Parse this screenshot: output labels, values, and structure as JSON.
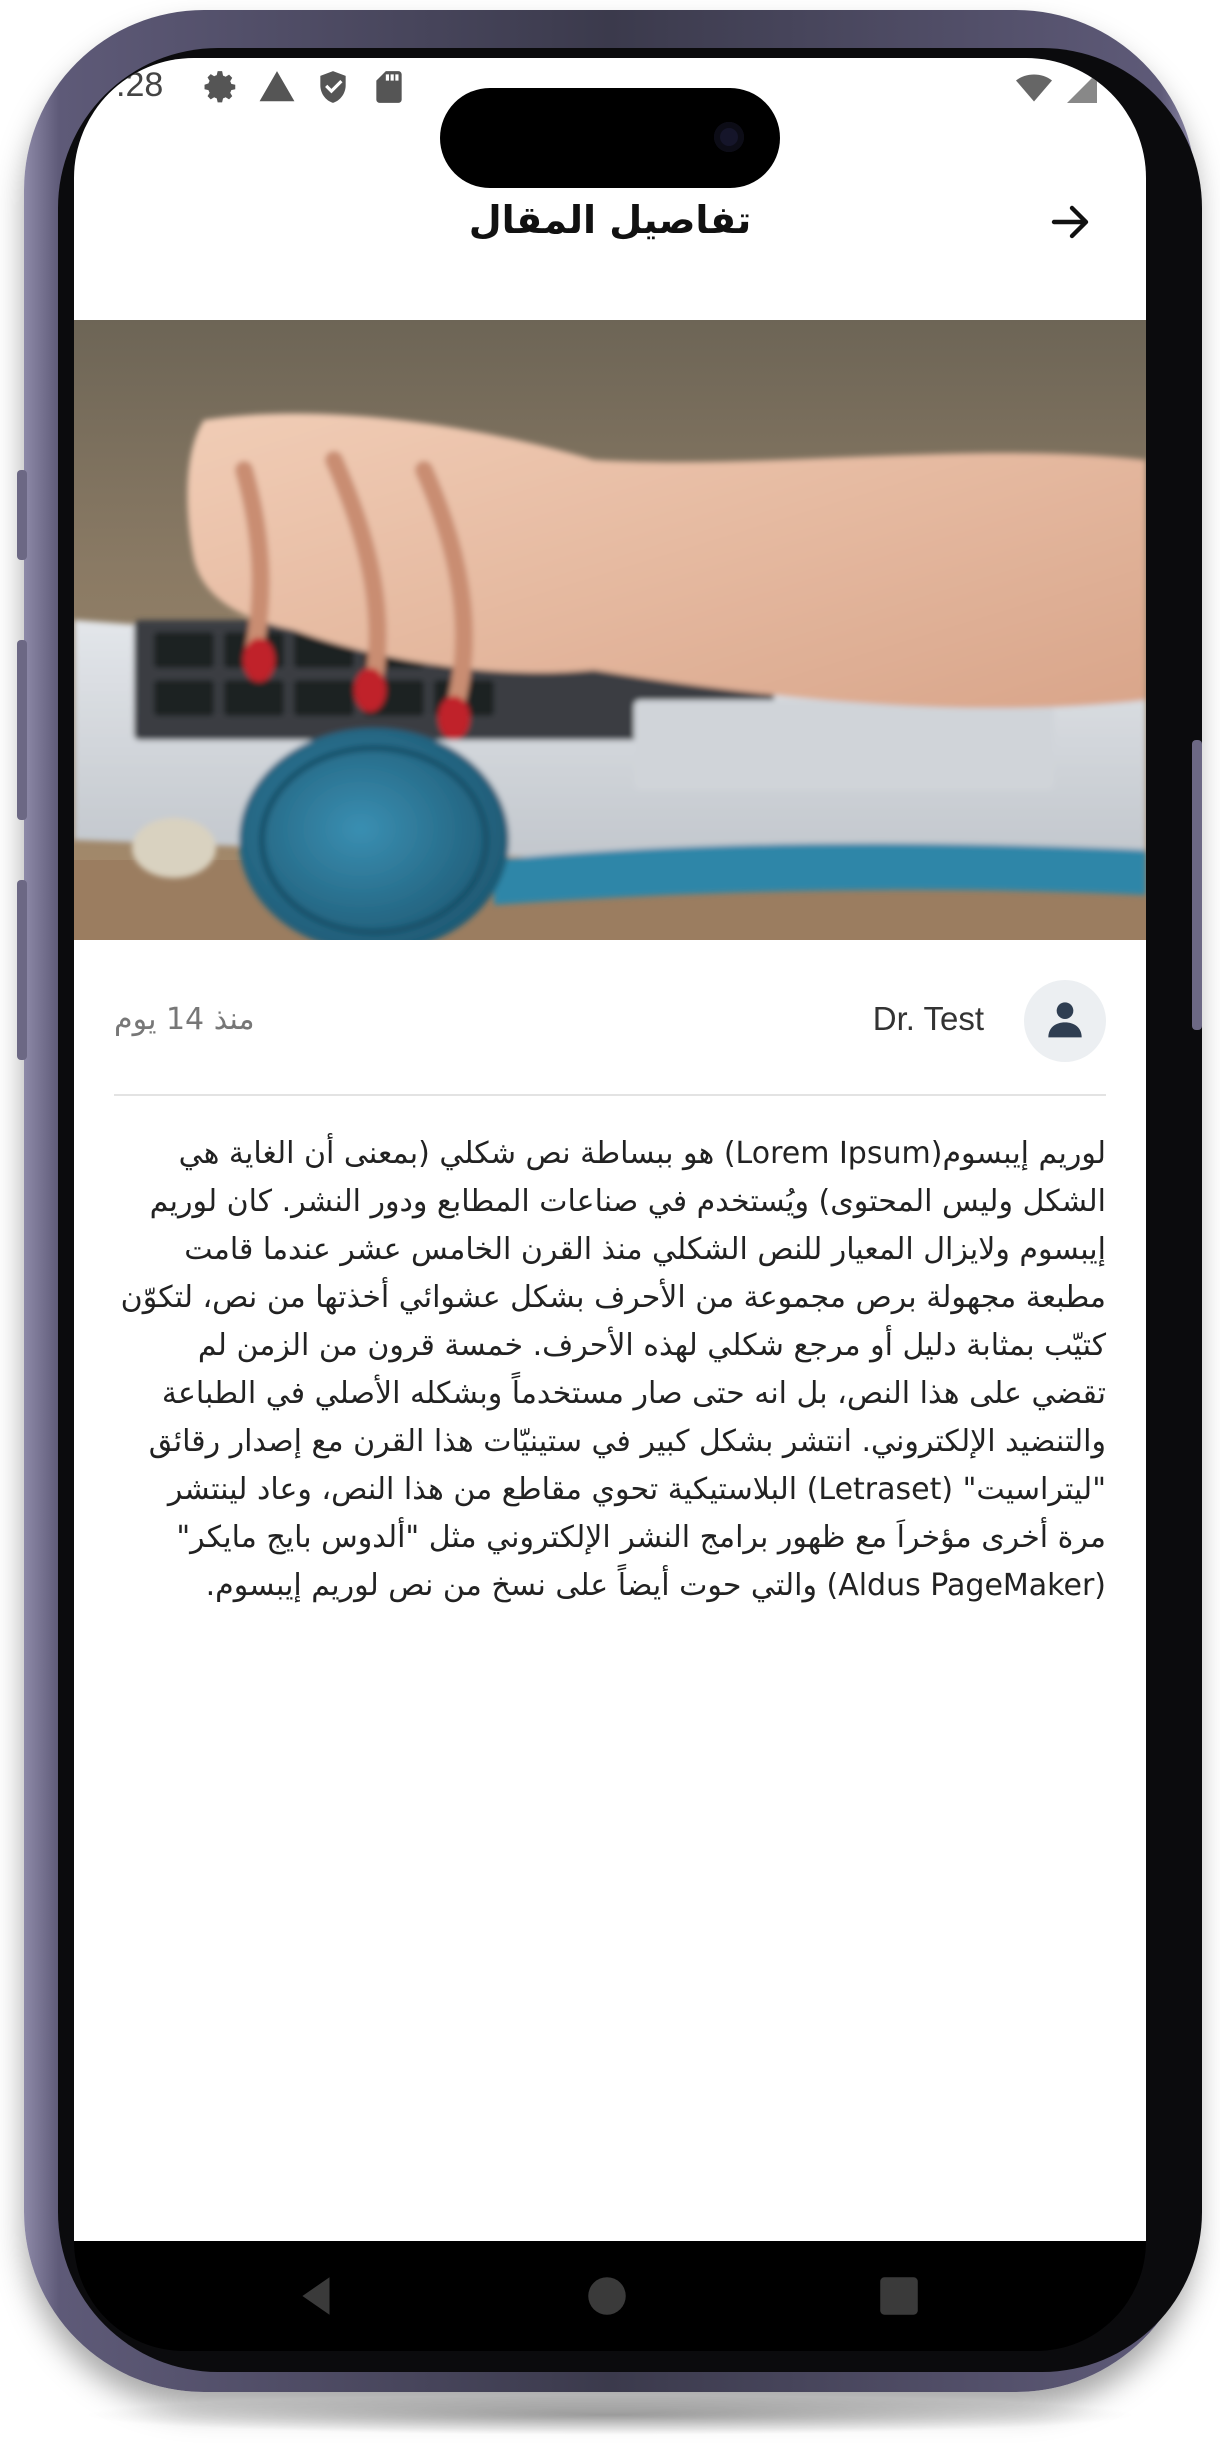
{
  "status_bar": {
    "time": ".28",
    "left_icons": [
      "gear-icon",
      "warning-icon",
      "shield-icon",
      "sd-card-icon"
    ],
    "right_icons": [
      "wifi-icon",
      "signal-icon"
    ]
  },
  "header": {
    "title": "تفاصيل المقال",
    "back_icon": "arrow-right-icon"
  },
  "article": {
    "image_alt": "hands typing on laptop with stethoscope",
    "author_name": "Dr. Test",
    "author_avatar_icon": "user-icon",
    "posted_ago": "منذ 14 يوم",
    "body": "لوريم إيبسوم(Lorem Ipsum) هو ببساطة نص شكلي (بمعنى أن الغاية هي الشكل وليس المحتوى) ويُستخدم في صناعات المطابع ودور النشر. كان لوريم إيبسوم ولايزال المعيار للنص الشكلي منذ القرن الخامس عشر عندما قامت مطبعة مجهولة برص مجموعة من الأحرف بشكل عشوائي أخذتها من نص، لتكوّن كتيّب بمثابة دليل أو مرجع شكلي لهذه الأحرف. خمسة قرون من الزمن لم تقضي على هذا النص، بل انه حتى صار مستخدماً وبشكله الأصلي في الطباعة والتنضيد الإلكتروني. انتشر بشكل كبير في ستينيّات هذا القرن مع إصدار رقائق \"ليتراسيت\" (Letraset) البلاستيكية تحوي مقاطع من هذا النص، وعاد لينتشر مرة أخرى مؤخراَ مع ظهور برامج النشر الإلكتروني مثل \"ألدوس بايج مايكر\" (Aldus PageMaker) والتي حوت أيضاً على نسخ من نص لوريم إيبسوم."
  },
  "nav_bar": {
    "buttons": [
      "back-triangle-icon",
      "home-circle-icon",
      "recents-square-icon"
    ]
  }
}
